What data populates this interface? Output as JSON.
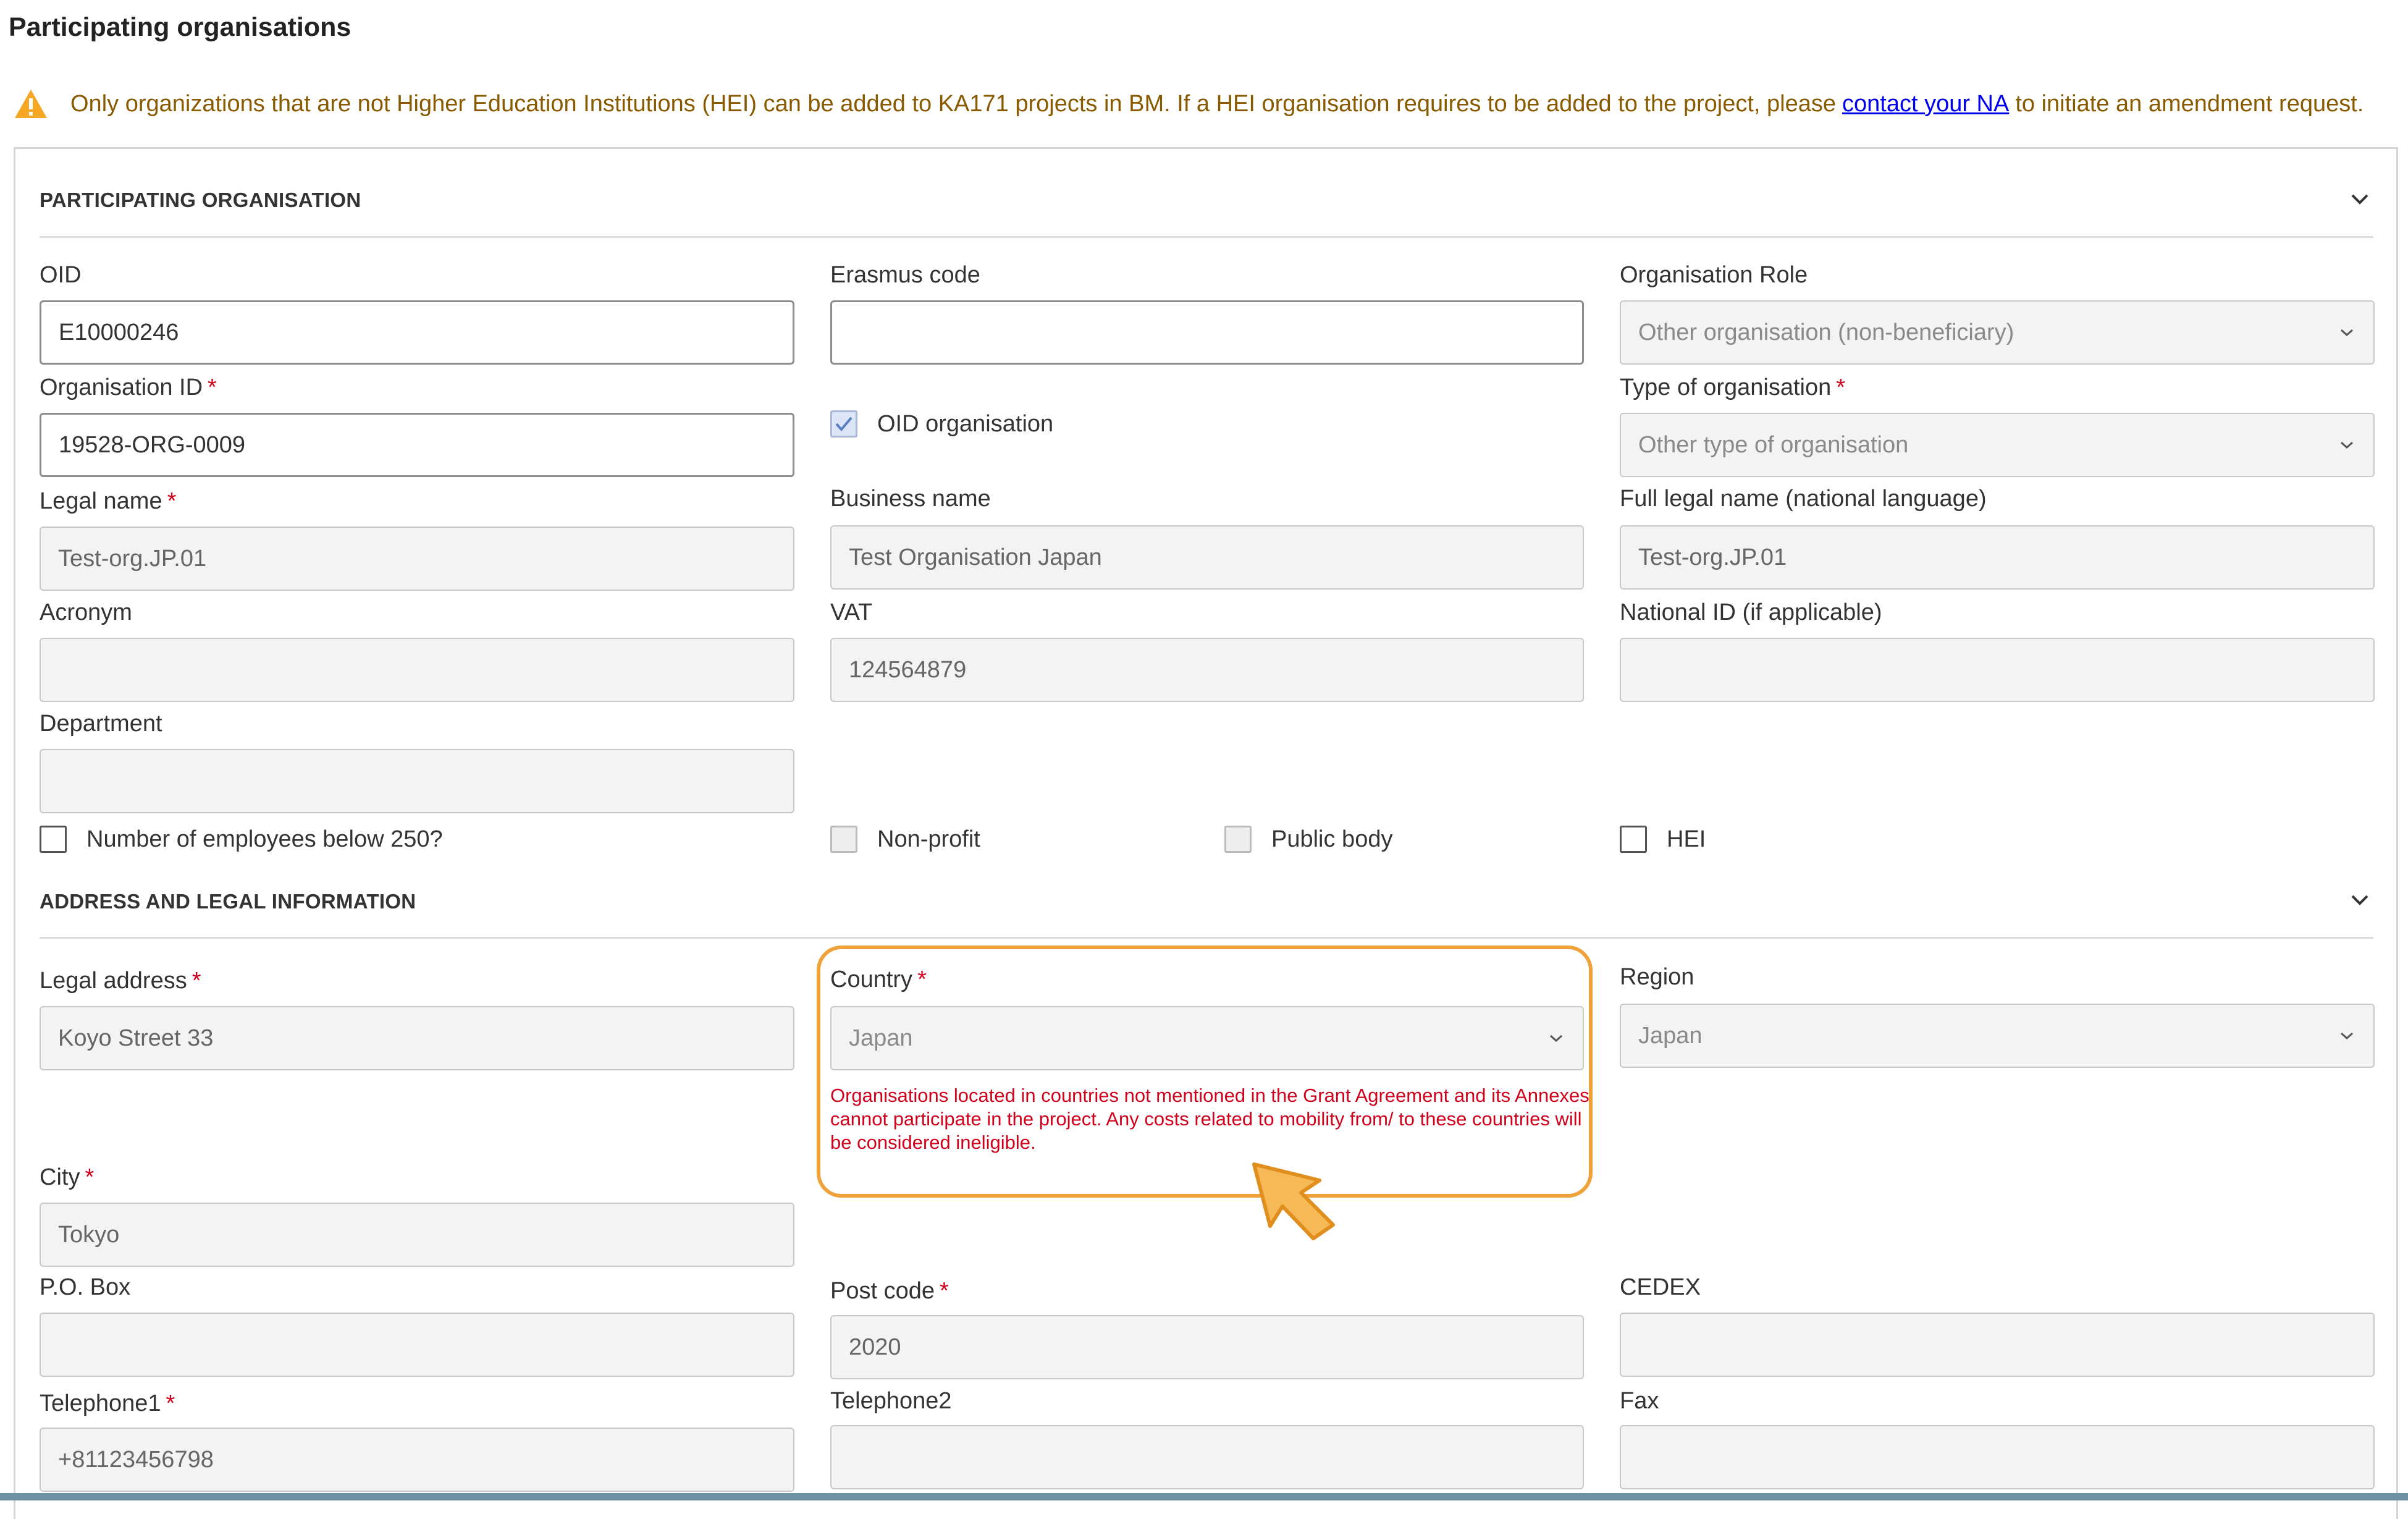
{
  "page": {
    "title": "Participating organisations",
    "warning": {
      "text_before": "Only organizations that are not Higher Education Institutions (HEI) can be added to KA171 projects in BM. If a HEI organisation requires to be added to the project, please",
      "link": "contact your NA",
      "text_after": "to initiate an amendment request.",
      "icon": "warning-icon"
    }
  },
  "sections": {
    "participating": {
      "title": "PARTICIPATING ORGANISATION",
      "icon": "chevron-down-icon"
    },
    "address": {
      "title": "ADDRESS AND LEGAL INFORMATION",
      "icon": "chevron-down-icon"
    }
  },
  "required_marker": "*",
  "fields": {
    "oid": {
      "label": "OID",
      "value": "E10000246"
    },
    "erasmus_code": {
      "label": "Erasmus code",
      "value": ""
    },
    "organisation_role": {
      "label": "Organisation Role",
      "value": "Other organisation (non-beneficiary)"
    },
    "organisation_id": {
      "label": "Organisation ID",
      "value": "19528-ORG-0009"
    },
    "oid_organisation": {
      "label": "OID organisation",
      "checked": true
    },
    "type_of_organisation": {
      "label": "Type of organisation",
      "value": "Other type of organisation"
    },
    "legal_name": {
      "label": "Legal name",
      "value": "Test-org.JP.01"
    },
    "business_name": {
      "label": "Business name",
      "value": "Test Organisation Japan"
    },
    "full_legal_name": {
      "label": "Full legal name (national language)",
      "value": "Test-org.JP.01"
    },
    "acronym": {
      "label": "Acronym",
      "value": ""
    },
    "vat": {
      "label": "VAT",
      "value": "124564879"
    },
    "national_id": {
      "label": "National ID (if applicable)",
      "value": ""
    },
    "department": {
      "label": "Department",
      "value": ""
    },
    "employees_below_250": {
      "label": "Number of employees below 250?",
      "checked": false
    },
    "non_profit": {
      "label": "Non-profit",
      "checked": false
    },
    "public_body": {
      "label": "Public body",
      "checked": false
    },
    "hei": {
      "label": "HEI",
      "checked": false
    },
    "legal_address": {
      "label": "Legal address",
      "value": "Koyo Street 33"
    },
    "country": {
      "label": "Country",
      "value": "Japan",
      "message": "Organisations located in countries not mentioned in the Grant Agreement and its Annexes cannot participate in the project. Any costs related to mobility from/ to these countries will be considered ineligible."
    },
    "region": {
      "label": "Region",
      "value": "Japan"
    },
    "city": {
      "label": "City",
      "value": "Tokyo"
    },
    "po_box": {
      "label": "P.O. Box",
      "value": ""
    },
    "post_code": {
      "label": "Post code",
      "value": "2020"
    },
    "cedex": {
      "label": "CEDEX",
      "value": ""
    },
    "telephone1": {
      "label": "Telephone1",
      "value": "+81123456798"
    },
    "telephone2": {
      "label": "Telephone2",
      "value": ""
    },
    "fax": {
      "label": "Fax",
      "value": ""
    }
  },
  "colors": {
    "highlight": "#f0a23a",
    "error_text": "#d0021b",
    "warning_text": "#8a5a00",
    "link": "#0000ee"
  }
}
